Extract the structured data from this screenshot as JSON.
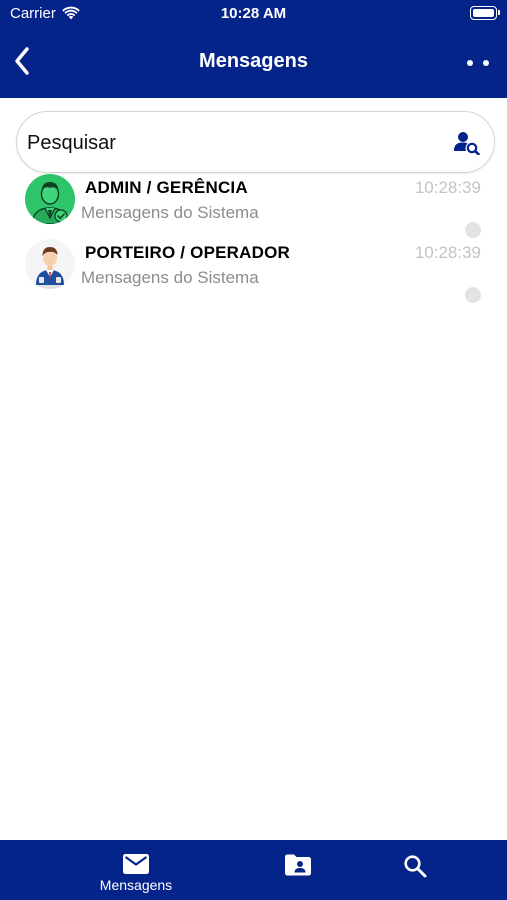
{
  "status_bar": {
    "carrier": "Carrier",
    "time": "10:28 AM"
  },
  "header": {
    "title": "Mensagens",
    "background_color": "#05248a"
  },
  "search": {
    "placeholder": "Pesquisar",
    "value": ""
  },
  "conversations": [
    {
      "name": "ADMIN / GERÊNCIA",
      "subtitle": "Mensagens do Sistema",
      "time": "10:28:39",
      "avatar": "admin-avatar-green",
      "unread": true
    },
    {
      "name": "PORTEIRO / OPERADOR",
      "subtitle": "Mensagens do Sistema",
      "time": "10:28:39",
      "avatar": "porteiro-avatar",
      "unread": true
    }
  ],
  "tabbar": {
    "items": [
      {
        "label": "Mensagens",
        "icon": "envelope-icon",
        "active": true
      },
      {
        "label": "",
        "icon": "contacts-folder-icon"
      },
      {
        "label": "",
        "icon": "search-icon"
      }
    ]
  },
  "colors": {
    "brand": "#05248a",
    "admin_avatar": "#2dc46a",
    "subtitle_text": "#8c8c8c",
    "time_text": "#c4c4c4"
  }
}
